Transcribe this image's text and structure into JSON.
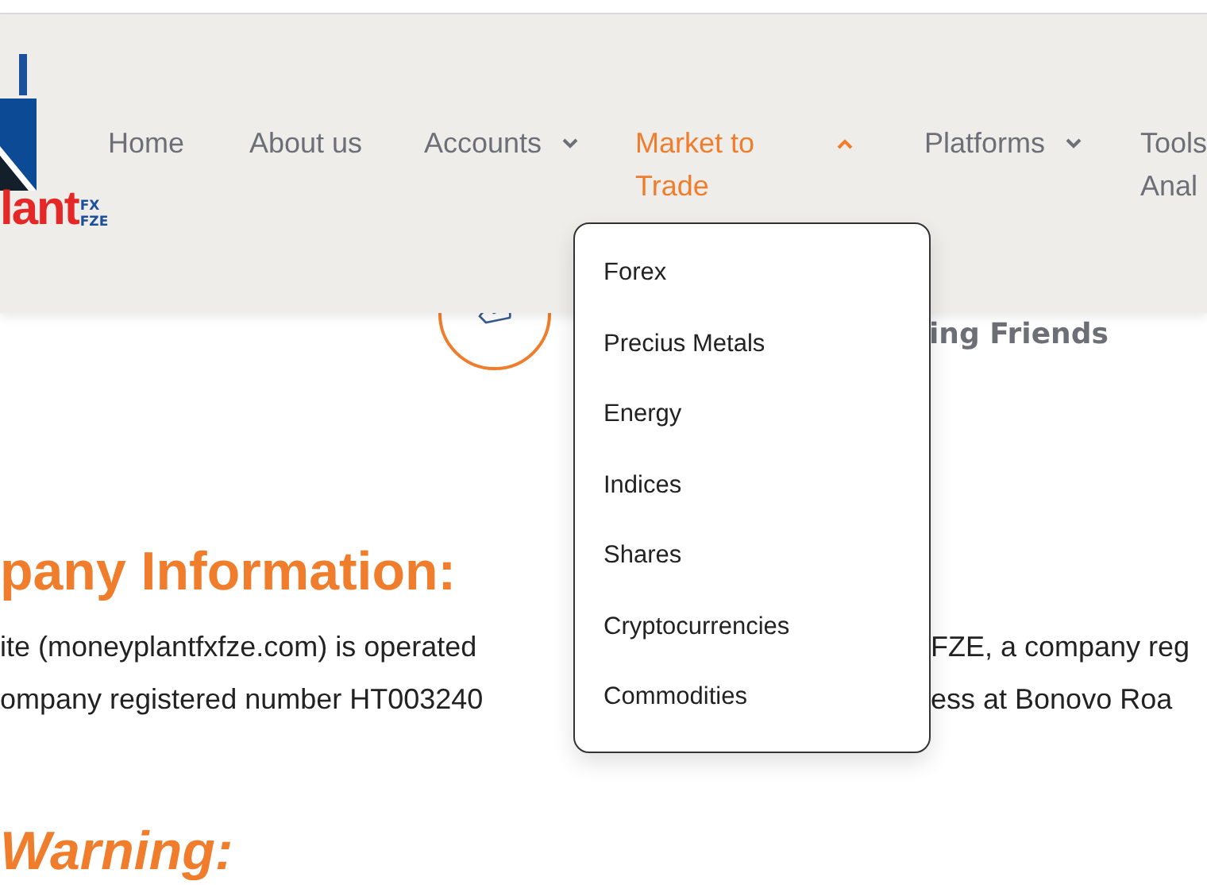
{
  "logo": {
    "text": "lant",
    "superscripts": [
      "FX",
      "FZE"
    ]
  },
  "nav": [
    {
      "label": "Home",
      "has_menu": false,
      "selected": false
    },
    {
      "label": "About us",
      "has_menu": false,
      "selected": false
    },
    {
      "label": "Accounts",
      "has_menu": true,
      "selected": false,
      "expanded": false
    },
    {
      "label": "Market to Trade",
      "has_menu": true,
      "selected": true,
      "expanded": true
    },
    {
      "label": "Platforms",
      "has_menu": true,
      "selected": false,
      "expanded": false
    },
    {
      "label": "Tools Anal",
      "selected": false
    }
  ],
  "dropdown": {
    "items": [
      "Forex",
      "Precius Metals",
      "Energy",
      "Indices",
      "Shares",
      "Cryptocurrencies",
      "Commodities"
    ]
  },
  "feature": {
    "label": "ing Friends"
  },
  "sections": [
    {
      "heading": "pany Information:",
      "lines": [
        [
          "ite (moneyplantfxfze.com) is operated",
          "FZE, a company reg"
        ],
        [
          "ompany registered number HT003240",
          "ess at Bonovo Roa"
        ]
      ]
    },
    {
      "heading": "Warning:"
    }
  ]
}
